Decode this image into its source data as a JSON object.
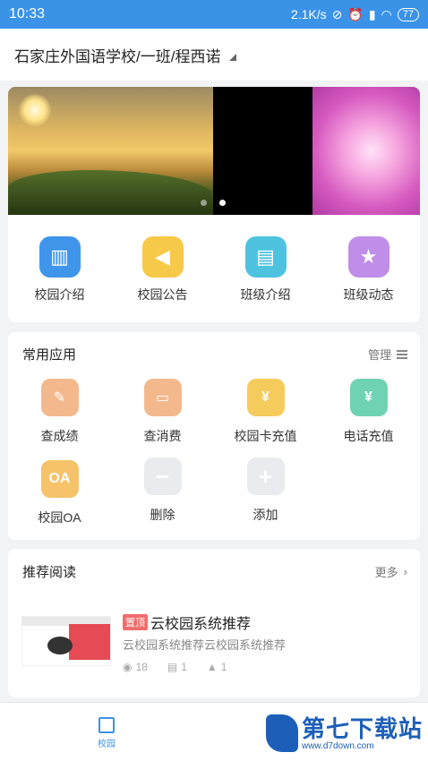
{
  "status": {
    "time": "10:33",
    "speed": "2.1K/s",
    "battery": "77"
  },
  "header": {
    "title": "石家庄外国语学校/一班/程西诺"
  },
  "quick": [
    {
      "label": "校园介绍",
      "icon": "building-icon",
      "color": "#3f95ea"
    },
    {
      "label": "校园公告",
      "icon": "megaphone-icon",
      "color": "#f7c948"
    },
    {
      "label": "班级介绍",
      "icon": "board-icon",
      "color": "#4ec3e0"
    },
    {
      "label": "班级动态",
      "icon": "star-icon",
      "color": "#c08ee8"
    }
  ],
  "apps": {
    "title": "常用应用",
    "manage": "管理",
    "items": [
      {
        "label": "查成绩",
        "icon": "grade-icon",
        "color": "#f3b98d"
      },
      {
        "label": "查消费",
        "icon": "wallet-icon",
        "color": "#f3b98d"
      },
      {
        "label": "校园卡充值",
        "icon": "card-recharge-icon",
        "color": "#f5cb5c"
      },
      {
        "label": "电话充值",
        "icon": "phone-recharge-icon",
        "color": "#6fd3b3"
      },
      {
        "label": "校园OA",
        "icon": "oa-icon",
        "color": "#f6c36a",
        "badge": "OA"
      },
      {
        "label": "删除",
        "icon": "minus-icon",
        "color": "#e9ebee"
      },
      {
        "label": "添加",
        "icon": "plus-icon",
        "color": "#e9ebee"
      }
    ]
  },
  "reading": {
    "title": "推荐阅读",
    "more": "更多",
    "news": {
      "tag": "置顶",
      "title": "云校园系统推荐",
      "desc": "云校园系统推荐云校园系统推荐",
      "views": "18",
      "comments": "1",
      "likes": "1"
    }
  },
  "tabs": [
    {
      "label": "校园"
    }
  ],
  "watermark": {
    "big": "第七下载站",
    "small": "www.d7down.com"
  }
}
